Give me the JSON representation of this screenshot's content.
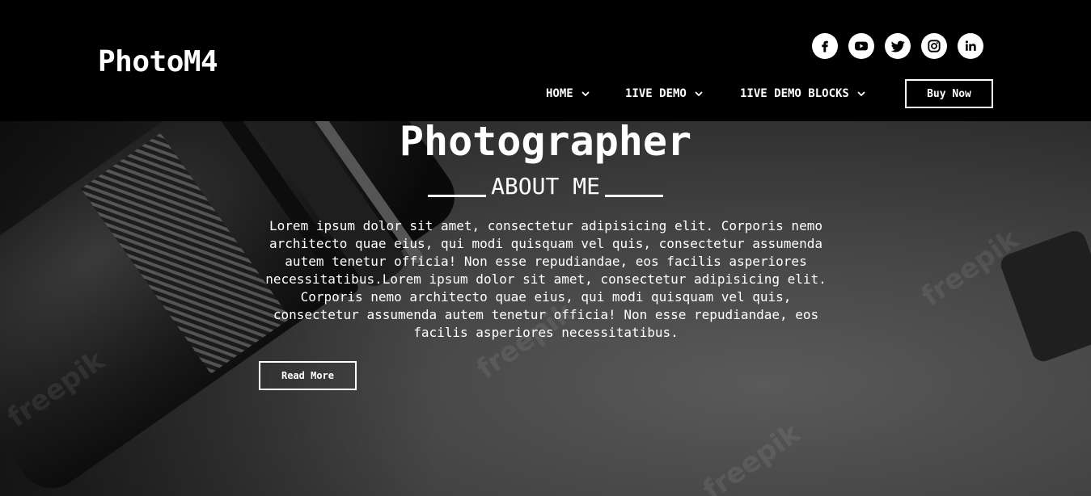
{
  "header": {
    "logo": "PhotoM4",
    "socials": [
      {
        "icon": "facebook-icon"
      },
      {
        "icon": "youtube-icon"
      },
      {
        "icon": "twitter-icon"
      },
      {
        "icon": "instagram-icon"
      },
      {
        "icon": "linkedin-icon"
      }
    ],
    "nav": [
      {
        "label": "HOME",
        "icon": "chevron-down-icon"
      },
      {
        "label": "1IVE DEMO",
        "icon": "chevron-down-icon"
      },
      {
        "label": "1IVE DEMO BLOCKS",
        "icon": "chevron-down-icon"
      }
    ],
    "buy_label": "Buy Now"
  },
  "hero": {
    "title": "Photographer",
    "subtitle": "ABOUT ME",
    "text": "Lorem ipsum dolor sit amet, consectetur adipisicing elit. Corporis nemo architecto quae eius, qui modi quisquam vel quis, consectetur assumenda autem tenetur officia! Non esse repudiandae, eos facilis asperiores necessitatibus.Lorem ipsum dolor sit amet, consectetur adipisicing elit. Corporis nemo architecto quae eius, qui modi quisquam vel quis, consectetur assumenda autem tenetur officia! Non esse repudiandae, eos facilis asperiores necessitatibus.",
    "read_more_label": "Read More",
    "watermark": "freepik"
  },
  "colors": {
    "header_bg": "#000000",
    "text": "#ffffff",
    "hero_bg": "#444444"
  }
}
